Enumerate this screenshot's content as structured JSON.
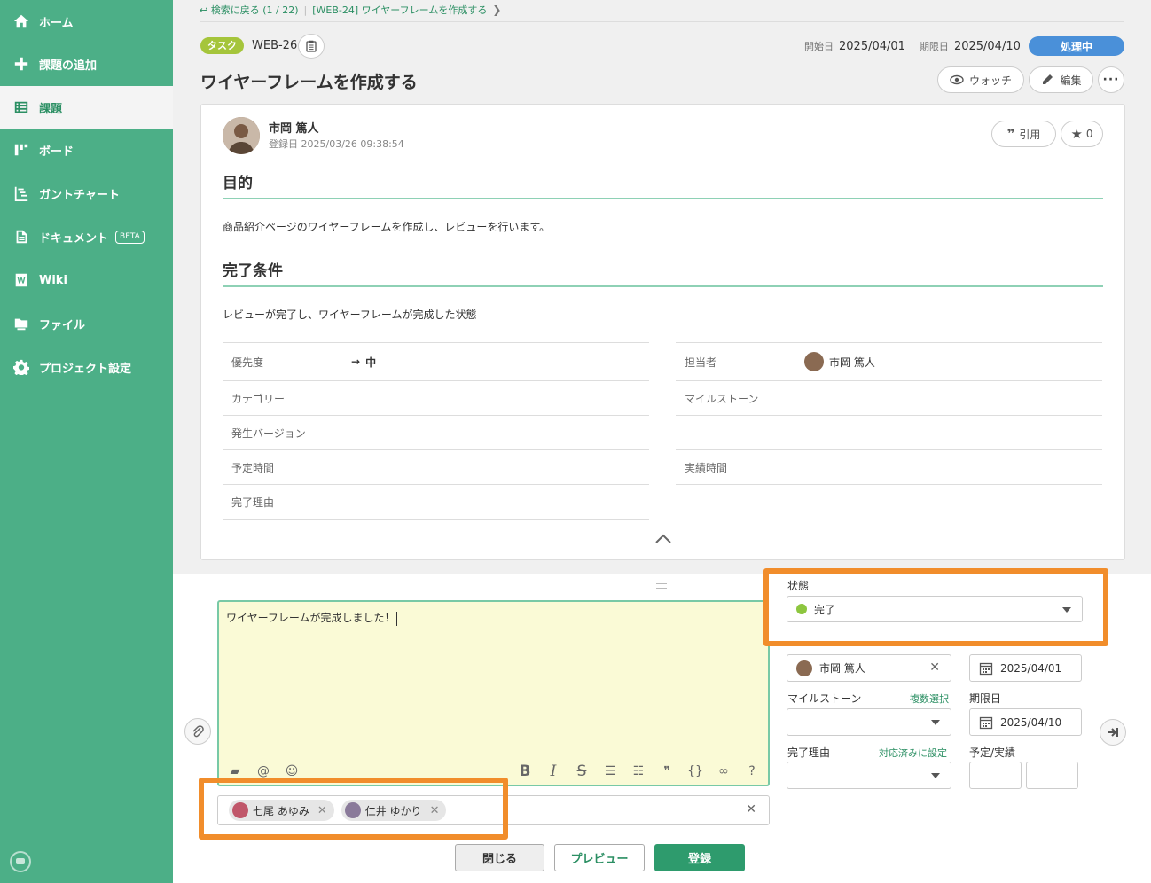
{
  "sidebar": {
    "items": [
      {
        "label": "ホーム",
        "icon": "home-icon"
      },
      {
        "label": "課題の追加",
        "icon": "plus-icon"
      },
      {
        "label": "課題",
        "icon": "list-icon"
      },
      {
        "label": "ボード",
        "icon": "board-icon"
      },
      {
        "label": "ガントチャート",
        "icon": "gantt-icon"
      },
      {
        "label": "ドキュメント",
        "icon": "document-icon",
        "badge": "BETA"
      },
      {
        "label": "Wiki",
        "icon": "wiki-icon"
      },
      {
        "label": "ファイル",
        "icon": "folder-icon"
      },
      {
        "label": "プロジェクト設定",
        "icon": "gear-icon"
      }
    ]
  },
  "breadcrumb": {
    "back": "検索に戻る (1 / 22)",
    "current": "[WEB-24] ワイヤーフレームを作成する"
  },
  "issue": {
    "type": "タスク",
    "key": "WEB-26",
    "start_label": "開始日",
    "start_date": "2025/04/01",
    "due_label": "期限日",
    "due_date": "2025/04/10",
    "status": "処理中",
    "title": "ワイヤーフレームを作成する",
    "watch_label": "ウォッチ",
    "edit_label": "編集"
  },
  "card": {
    "author": "市岡 篤人",
    "created": "登録日  2025/03/26 09:38:54",
    "quote_label": "引用",
    "star_count": "0",
    "section1_title": "目的",
    "section1_text": "商品紹介ページのワイヤーフレームを作成し、レビューを行います。",
    "section2_title": "完了条件",
    "section2_text": "レビューが完了し、ワイヤーフレームが完成した状態",
    "props_left": [
      {
        "label": "優先度",
        "value": "中"
      },
      {
        "label": "カテゴリー",
        "value": ""
      },
      {
        "label": "発生バージョン",
        "value": ""
      },
      {
        "label": "予定時間",
        "value": ""
      },
      {
        "label": "完了理由",
        "value": ""
      }
    ],
    "props_right": [
      {
        "label": "担当者",
        "value": "市岡 篤人"
      },
      {
        "label": "マイルストーン",
        "value": ""
      },
      {
        "label": "",
        "value": ""
      },
      {
        "label": "実績時間",
        "value": ""
      }
    ]
  },
  "editor": {
    "comment": "ワイヤーフレームが完成しました！",
    "notify": [
      "七尾 あゆみ",
      "仁井 ゆかり"
    ],
    "status_label": "状態",
    "status_value": "完了",
    "assignee_value": "市岡 篤人",
    "start_value": "2025/04/01",
    "milestone_label": "マイルストーン",
    "milestone_link": "複数選択",
    "due_label": "期限日",
    "due_value": "2025/04/10",
    "resolution_label": "完了理由",
    "resolution_link": "対応済みに設定",
    "time_label": "予定/実績",
    "close_label": "閉じる",
    "preview_label": "プレビュー",
    "submit_label": "登録"
  },
  "colors": {
    "sidebar": "#4caf87",
    "accent": "#2b8f63",
    "status_badge": "#4a90d9",
    "highlight": "#f18d2b"
  }
}
